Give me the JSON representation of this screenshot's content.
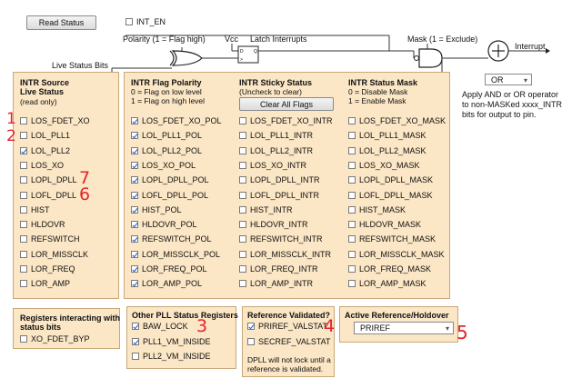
{
  "top": {
    "read_status_label": "Read Status",
    "int_en_label": "INT_EN",
    "polarity_label": "Polarity (1 = Flag high)",
    "vcc_label": "Vcc",
    "latch_label": "Latch Interrupts",
    "mask_label": "Mask (1 = Exclude)",
    "interrupt_label": "Interrupt",
    "live_status_label": "Live Status Bits",
    "operator_select": "OR",
    "operator_note": [
      "Apply AND or OR operator",
      "to non-MASKed xxxx_INTR",
      "bits for output to pin."
    ]
  },
  "intr_source": {
    "title1": "INTR Source",
    "title2": "Live Status",
    "subtitle": "(read only)",
    "items": [
      {
        "label": "LOS_FDET_XO",
        "checked": false
      },
      {
        "label": "LOL_PLL1",
        "checked": false
      },
      {
        "label": "LOL_PLL2",
        "checked": true
      },
      {
        "label": "LOS_XO",
        "checked": false
      },
      {
        "label": "LOPL_DPLL",
        "checked": false
      },
      {
        "label": "LOFL_DPLL",
        "checked": false
      },
      {
        "label": "HIST",
        "checked": false
      },
      {
        "label": "HLDOVR",
        "checked": false
      },
      {
        "label": "REFSWITCH",
        "checked": false
      },
      {
        "label": "LOR_MISSCLK",
        "checked": false
      },
      {
        "label": "LOR_FREQ",
        "checked": false
      },
      {
        "label": "LOR_AMP",
        "checked": false
      }
    ]
  },
  "flag_polarity": {
    "title": "INTR Flag Polarity",
    "line1": "0 = Flag on low level",
    "line2": "1 = Flag on high level",
    "items": [
      {
        "label": "LOS_FDET_XO_POL",
        "checked": true
      },
      {
        "label": "LOL_PLL1_POL",
        "checked": true
      },
      {
        "label": "LOL_PLL2_POL",
        "checked": true
      },
      {
        "label": "LOS_XO_POL",
        "checked": true
      },
      {
        "label": "LOPL_DPLL_POL",
        "checked": true
      },
      {
        "label": "LOFL_DPLL_POL",
        "checked": true
      },
      {
        "label": "HIST_POL",
        "checked": true
      },
      {
        "label": "HLDOVR_POL",
        "checked": true
      },
      {
        "label": "REFSWITCH_POL",
        "checked": true
      },
      {
        "label": "LOR_MISSCLK_POL",
        "checked": true
      },
      {
        "label": "LOR_FREQ_POL",
        "checked": true
      },
      {
        "label": "LOR_AMP_POL",
        "checked": true
      }
    ]
  },
  "sticky_status": {
    "title": "INTR Sticky Status",
    "subtitle": "(Uncheck to clear)",
    "clear_button": "Clear All Flags",
    "items": [
      {
        "label": "LOS_FDET_XO_INTR",
        "checked": false
      },
      {
        "label": "LOL_PLL1_INTR",
        "checked": false
      },
      {
        "label": "LOL_PLL2_INTR",
        "checked": false
      },
      {
        "label": "LOS_XO_INTR",
        "checked": false
      },
      {
        "label": "LOPL_DPLL_INTR",
        "checked": false
      },
      {
        "label": "LOFL_DPLL_INTR",
        "checked": false
      },
      {
        "label": "HIST_INTR",
        "checked": false
      },
      {
        "label": "HLDOVR_INTR",
        "checked": false
      },
      {
        "label": "REFSWITCH_INTR",
        "checked": false
      },
      {
        "label": "LOR_MISSCLK_INTR",
        "checked": false
      },
      {
        "label": "LOR_FREQ_INTR",
        "checked": false
      },
      {
        "label": "LOR_AMP_INTR",
        "checked": false
      }
    ]
  },
  "status_mask": {
    "title": "INTR Status Mask",
    "line1": "0 = Disable Mask",
    "line2": "1 = Enable Mask",
    "items": [
      {
        "label": "LOS_FDET_XO_MASK",
        "checked": false
      },
      {
        "label": "LOL_PLL1_MASK",
        "checked": false
      },
      {
        "label": "LOL_PLL2_MASK",
        "checked": false
      },
      {
        "label": "LOS_XO_MASK",
        "checked": false
      },
      {
        "label": "LOPL_DPLL_MASK",
        "checked": false
      },
      {
        "label": "LOFL_DPLL_MASK",
        "checked": false
      },
      {
        "label": "HIST_MASK",
        "checked": false
      },
      {
        "label": "HLDOVR_MASK",
        "checked": false
      },
      {
        "label": "REFSWITCH_MASK",
        "checked": false
      },
      {
        "label": "LOR_MISSCLK_MASK",
        "checked": false
      },
      {
        "label": "LOR_FREQ_MASK",
        "checked": false
      },
      {
        "label": "LOR_AMP_MASK",
        "checked": false
      }
    ]
  },
  "registers_panel": {
    "title1": "Registers interacting with",
    "title2": "status bits",
    "items": [
      {
        "label": "XO_FDET_BYP",
        "checked": false
      }
    ]
  },
  "pll_status": {
    "title": "Other PLL Status Registers",
    "items": [
      {
        "label": "BAW_LOCK",
        "checked": true
      },
      {
        "label": "PLL1_VM_INSIDE",
        "checked": true
      },
      {
        "label": "PLL2_VM_INSIDE",
        "checked": false
      }
    ]
  },
  "reference_validated": {
    "title": "Reference Validated?",
    "items": [
      {
        "label": "PRIREF_VALSTAT",
        "checked": true
      },
      {
        "label": "SECREF_VALSTAT",
        "checked": false
      }
    ],
    "note_line1": "DPLL will not lock until a",
    "note_line2": "reference is validated."
  },
  "active_reference": {
    "title": "Active Reference/Holdover",
    "selected": "PRIREF"
  },
  "annotations": [
    "1",
    "2",
    "7",
    "6",
    "3",
    "4",
    "5"
  ],
  "colors": {
    "panel_bg": "#fbe6c5",
    "panel_border": "#c9a878",
    "annotation": "#e3242b",
    "check": "#1a57c8"
  }
}
